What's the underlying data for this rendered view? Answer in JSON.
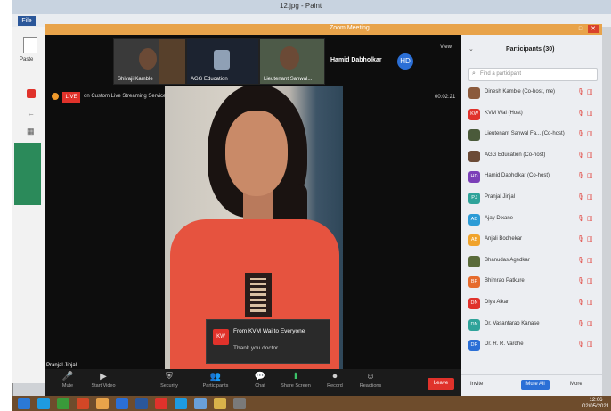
{
  "paint": {
    "title": "12.jpg - Paint",
    "file_tab": "File",
    "paste_label": "Paste"
  },
  "zoom": {
    "title": "Zoom Meeting",
    "view_label": "View",
    "live_badge": "LIVE",
    "live_text": "on Custom Live Streaming Service",
    "timer": "00:02:21",
    "active_speaker": "Hamid Dabholkar",
    "active_speaker_initials": "HD",
    "video_name": "Pranjal Jinjal",
    "thumbnails": [
      {
        "label": "Shivaji Kamble"
      },
      {
        "label": "AGG Education"
      },
      {
        "label": "Lieutenant Sanwal..."
      }
    ],
    "chat_toast": {
      "icon": "KW",
      "from": "From KVM Wai to Everyone",
      "message": "Thank you doctor"
    },
    "toolbar": [
      {
        "icon": "mic-icon",
        "glyph": "🎤",
        "label": "Mute"
      },
      {
        "icon": "video-icon",
        "glyph": "▶",
        "label": "Start Video"
      },
      {
        "icon": "security-icon",
        "glyph": "⛨",
        "label": "Security"
      },
      {
        "icon": "participants-icon",
        "glyph": "👥",
        "label": "Participants"
      },
      {
        "icon": "chat-icon",
        "glyph": "💬",
        "label": "Chat"
      },
      {
        "icon": "share-icon",
        "glyph": "⬆",
        "label": "Share Screen"
      },
      {
        "icon": "record-icon",
        "glyph": "⏺",
        "label": "Record"
      },
      {
        "icon": "reactions-icon",
        "glyph": "☺",
        "label": "Reactions"
      }
    ],
    "leave_label": "Leave"
  },
  "participants": {
    "title": "Participants (30)",
    "search_placeholder": "Find a participant",
    "rows": [
      {
        "initials": "",
        "name": "Dinesh Kamble (Co-host, me)",
        "color": "#8b5a3c"
      },
      {
        "initials": "KW",
        "name": "KVM Wai (Host)",
        "color": "#e0322b"
      },
      {
        "initials": "",
        "name": "Lieutenant Sanwal Fa... (Co-host)",
        "color": "#4a5a3a"
      },
      {
        "initials": "",
        "name": "AGG Education (Co-host)",
        "color": "#6b4a36"
      },
      {
        "initials": "HD",
        "name": "Hamid Dabholkar (Co-host)",
        "color": "#7b3fb8"
      },
      {
        "initials": "PJ",
        "name": "Pranjal Jinjal",
        "color": "#2fa39a"
      },
      {
        "initials": "AD",
        "name": "Ajay Dixane",
        "color": "#2b9bd6"
      },
      {
        "initials": "AB",
        "name": "Anjali Bodhekar",
        "color": "#f0a32c"
      },
      {
        "initials": "",
        "name": "Bhanudas Agedkar",
        "color": "#5a6b3a"
      },
      {
        "initials": "BP",
        "name": "Bhimrao Patkure",
        "color": "#e66b2c"
      },
      {
        "initials": "DN",
        "name": "Diya Alkari",
        "color": "#e0322b"
      },
      {
        "initials": "DN",
        "name": "Dr. Vasantarao Kanase",
        "color": "#2fa39a"
      },
      {
        "initials": "DR",
        "name": "Dr. R. R. Vardhe",
        "color": "#2b6fd6"
      }
    ],
    "invite_label": "Invite",
    "mute_all_label": "Mute All",
    "more_label": "More"
  },
  "taskbar": {
    "time": "12:06",
    "date": "02/05/2021"
  },
  "colors": {
    "zoom_orange": "#e8a34a",
    "zoom_blue": "#2b6fd6",
    "leave_red": "#e0322b"
  }
}
